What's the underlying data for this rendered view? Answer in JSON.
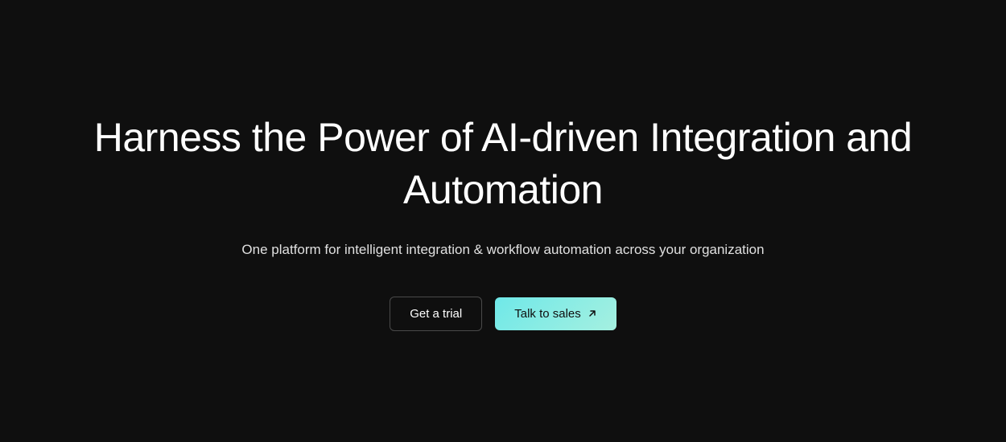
{
  "hero": {
    "heading": "Harness the Power of AI-driven Integration and Automation",
    "subheading": "One platform for intelligent integration & workflow automation across your organization",
    "buttons": {
      "trial_label": "Get a trial",
      "sales_label": "Talk to sales"
    }
  }
}
